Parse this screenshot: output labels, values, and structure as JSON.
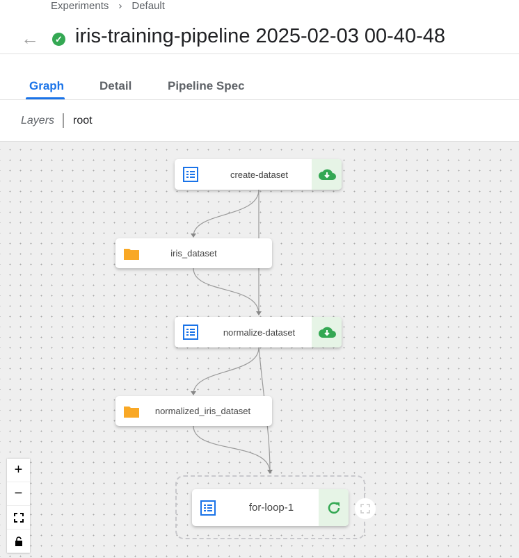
{
  "breadcrumb": [
    "Experiments",
    "Default"
  ],
  "header": {
    "title": "iris-training-pipeline 2025-02-03 00-40-48",
    "status": "succeeded",
    "status_color": "#34a853"
  },
  "tabs": [
    {
      "label": "Graph",
      "active": true
    },
    {
      "label": "Detail"
    },
    {
      "label": "Pipeline Spec"
    }
  ],
  "layers": {
    "label": "Layers",
    "current": "root"
  },
  "graph": {
    "nodes": [
      {
        "label": "create-dataset",
        "type": "execution",
        "status": "cached"
      },
      {
        "label": "iris_dataset",
        "type": "artifact"
      },
      {
        "label": "normalize-dataset",
        "type": "execution",
        "status": "cached"
      },
      {
        "label": "normalized_iris_dataset",
        "type": "artifact"
      },
      {
        "label": "for-loop-1",
        "type": "sub-dag",
        "status": "running"
      }
    ]
  },
  "zoom_controls": [
    "zoom-in",
    "zoom-out",
    "fit-view",
    "toggle-interactivity"
  ]
}
